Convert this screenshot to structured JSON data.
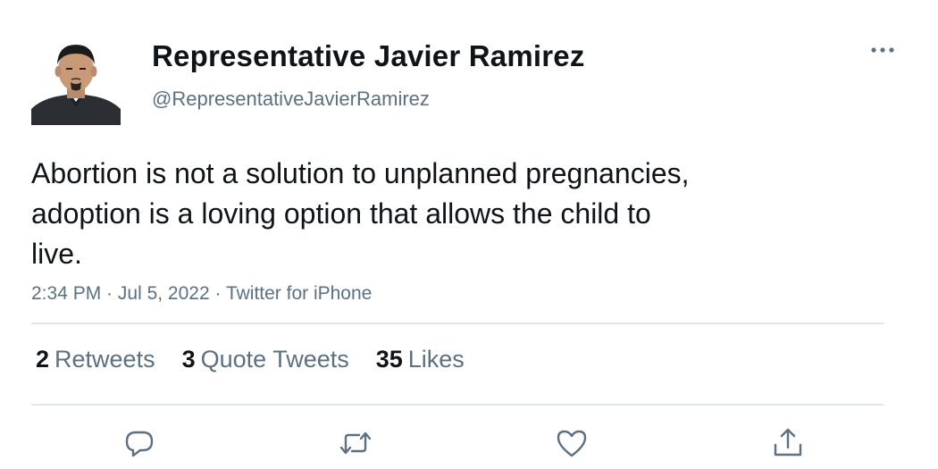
{
  "user": {
    "display_name": "Representative Javier Ramirez",
    "handle": "@RepresentativeJavierRamirez",
    "avatar_icon": "profile-photo"
  },
  "tweet": {
    "text": "Abortion is not a solution to unplanned pregnancies,\nadoption is a loving option that allows the child to\nlive.",
    "time": "2:34 PM",
    "date": "Jul 5, 2022",
    "source": "Twitter for iPhone",
    "separator": " · "
  },
  "stats": {
    "retweets_count": "2",
    "retweets_label": "Retweets",
    "quotes_count": "3",
    "quotes_label": "Quote Tweets",
    "likes_count": "35",
    "likes_label": "Likes"
  },
  "actions": {
    "reply_icon": "reply-icon",
    "retweet_icon": "retweet-icon",
    "like_icon": "heart-icon",
    "share_icon": "share-icon",
    "more_icon": "more-icon"
  },
  "colors": {
    "text": "#0f1419",
    "secondary": "#5b7083",
    "divider": "#e1e6ea"
  }
}
